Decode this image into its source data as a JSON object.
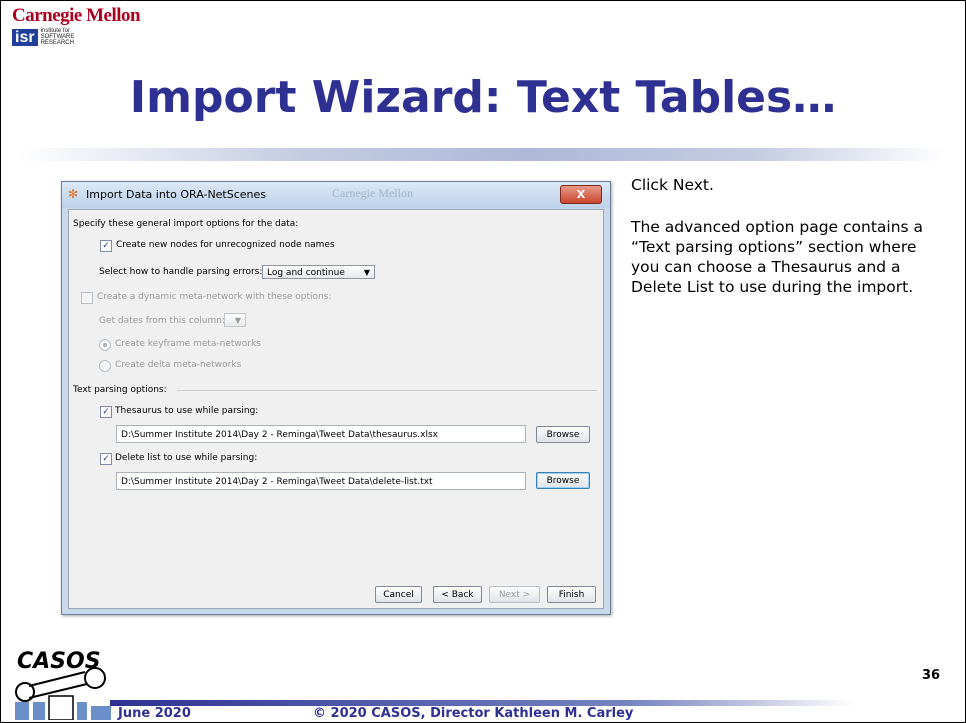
{
  "header": {
    "university": "Carnegie Mellon",
    "isr_logo": "isr",
    "isr_text": [
      "institute for",
      "SOFTWARE",
      "RESEARCH"
    ],
    "title": "Import Wizard: Text Tables…"
  },
  "dialog": {
    "title": "Import Data into ORA-NetScenes",
    "watermark": "Carnegie Mellon",
    "close_label": "X",
    "general_heading": "Specify these general import options for the data:",
    "create_nodes_label": "Create new nodes for unrecognized node names",
    "create_nodes_checked": true,
    "parsing_errors_label": "Select how to handle parsing errors:",
    "parsing_errors_value": "Log and continue",
    "dynamic_label": "Create a dynamic meta-network with these options:",
    "dynamic_checked": false,
    "dates_label": "Get dates from this column:",
    "keyframe_label": "Create keyframe meta-networks",
    "delta_label": "Create delta meta-networks",
    "text_parsing_heading": "Text parsing options:",
    "thesaurus_label": "Thesaurus to use while parsing:",
    "thesaurus_checked": true,
    "thesaurus_path": "D:\\Summer Institute 2014\\Day 2 - Reminga\\Tweet Data\\thesaurus.xlsx",
    "delete_label": "Delete list to use while parsing:",
    "delete_checked": true,
    "delete_path": "D:\\Summer Institute 2014\\Day 2 - Reminga\\Tweet Data\\delete-list.txt",
    "browse_label": "Browse",
    "cancel_label": "Cancel",
    "back_label": "< Back",
    "next_label": "Next >",
    "finish_label": "Finish"
  },
  "side_text": {
    "p1": "Click Next.",
    "p2": "The advanced option page contains a “Text parsing options” section where you can choose a Thesaurus and a Delete List to use during the import."
  },
  "footer": {
    "logo_text": "CASOS",
    "date": "June 2020",
    "copyright": "© 2020 CASOS, Director Kathleen M. Carley",
    "page_number": "36"
  },
  "colors": {
    "title_blue": "#2e3192",
    "cmu_red": "#b00020",
    "dialog_frame": "#c8d9ec"
  }
}
